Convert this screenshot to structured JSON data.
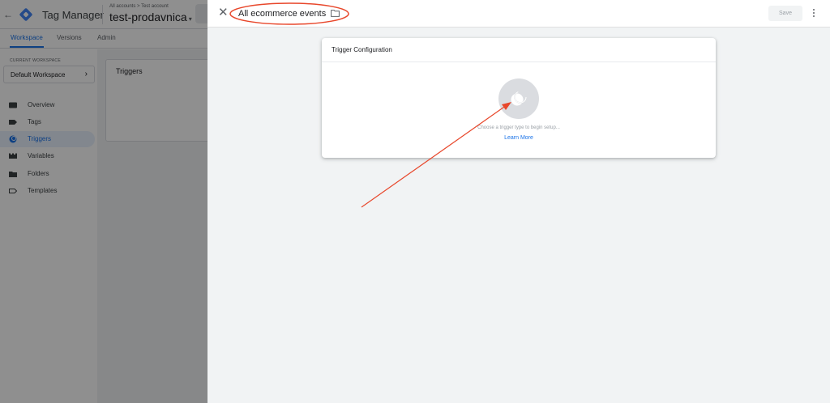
{
  "app": {
    "title": "Tag Manager",
    "breadcrumb": "All accounts > Test account",
    "container_name": "test-prodavnica",
    "caret": "▾",
    "back": "←"
  },
  "nav_tabs": [
    {
      "label": "Workspace",
      "active": true
    },
    {
      "label": "Versions",
      "active": false
    },
    {
      "label": "Admin",
      "active": false
    }
  ],
  "sidebar": {
    "current_workspace_label": "CURRENT WORKSPACE",
    "workspace_name": "Default Workspace",
    "items": [
      {
        "label": "Overview",
        "icon": "overview-icon",
        "active": false
      },
      {
        "label": "Tags",
        "icon": "tag-icon",
        "active": false
      },
      {
        "label": "Triggers",
        "icon": "trigger-icon",
        "active": true
      },
      {
        "label": "Variables",
        "icon": "variables-icon",
        "active": false
      },
      {
        "label": "Folders",
        "icon": "folder-icon",
        "active": false
      },
      {
        "label": "Templates",
        "icon": "template-icon",
        "active": false
      }
    ]
  },
  "main": {
    "card_title": "Triggers"
  },
  "editor": {
    "close": "✕",
    "trigger_name": "All ecommerce events",
    "save_label": "Save",
    "config_title": "Trigger Configuration",
    "choose_hint": "Choose a trigger type to begin setup...",
    "learn_more": "Learn More"
  },
  "colors": {
    "accent": "#1a73e8",
    "annotation": "#e8472b",
    "sheet_bg": "#f1f3f4"
  }
}
